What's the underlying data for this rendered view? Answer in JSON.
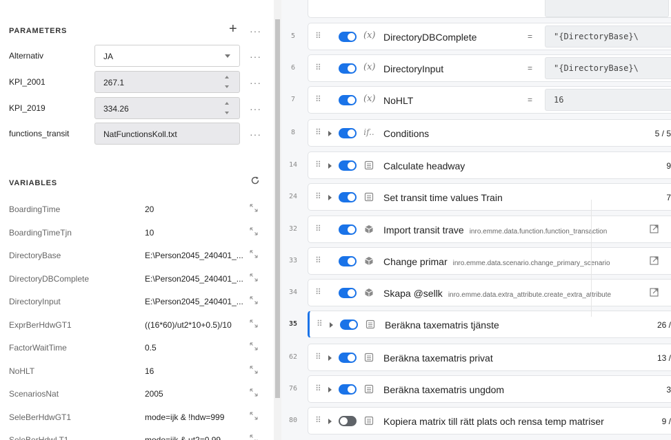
{
  "parameters": {
    "title": "PARAMETERS",
    "add_label": "+",
    "more_label": "···",
    "rows": [
      {
        "label": "Alternativ",
        "value": "JA",
        "kind": "select"
      },
      {
        "label": "KPI_2001",
        "value": "267.1",
        "kind": "number"
      },
      {
        "label": "KPI_2019",
        "value": "334.26",
        "kind": "number"
      },
      {
        "label": "functions_transit",
        "value": "NatFunctionsKoll.txt",
        "kind": "text"
      }
    ]
  },
  "variables": {
    "title": "VARIABLES",
    "refresh_icon": "refresh-icon",
    "rows": [
      {
        "name": "BoardingTime",
        "value": "20"
      },
      {
        "name": "BoardingTimeTjn",
        "value": "10"
      },
      {
        "name": "DirectoryBase",
        "value": "E:\\Person2045_240401_..."
      },
      {
        "name": "DirectoryDBComplete",
        "value": "E:\\Person2045_240401_..."
      },
      {
        "name": "DirectoryInput",
        "value": "E:\\Person2045_240401_..."
      },
      {
        "name": "ExprBerHdwGT1",
        "value": "((16*60)/ut2*10+0.5)/10"
      },
      {
        "name": "FactorWaitTime",
        "value": "0.5"
      },
      {
        "name": "NoHLT",
        "value": "16"
      },
      {
        "name": "ScenariosNat",
        "value": "2005"
      },
      {
        "name": "SeleBerHdwGT1",
        "value": "mode=ijk & !hdw=999"
      },
      {
        "name": "SeleBerHdwLT1",
        "value": "mode=ijk & ut2=0.99"
      }
    ]
  },
  "steps": [
    {
      "line": "5",
      "type": "var",
      "title": "DirectoryDBComplete",
      "eq": "=",
      "value": "\"{DirectoryBase}\\",
      "enabled": true
    },
    {
      "line": "6",
      "type": "var",
      "title": "DirectoryInput",
      "eq": "=",
      "value": "\"{DirectoryBase}\\",
      "enabled": true
    },
    {
      "line": "7",
      "type": "var",
      "title": "NoHLT",
      "eq": "=",
      "value": "16",
      "enabled": true
    },
    {
      "line": "8",
      "type": "if",
      "title": "Conditions",
      "count": "5 / 5",
      "expand": true,
      "enabled": true
    },
    {
      "line": "14",
      "type": "group",
      "title": "Calculate headway",
      "count": "9",
      "expand": true,
      "enabled": true
    },
    {
      "line": "24",
      "type": "group",
      "title": "Set transit time values Train",
      "count": "7",
      "expand": true,
      "enabled": true
    },
    {
      "line": "32",
      "type": "tool",
      "title": "Import transit trave",
      "sub": "inro.emme.data.function.function_transaction",
      "enabled": true
    },
    {
      "line": "33",
      "type": "tool",
      "title": "Change primar",
      "sub": "inro.emme.data.scenario.change_primary_scenario",
      "enabled": true
    },
    {
      "line": "34",
      "type": "tool",
      "title": "Skapa @sellk",
      "sub": "inro.emme.data.extra_attribute.create_extra_attribute",
      "enabled": true
    },
    {
      "line": "35",
      "type": "group",
      "title": "Beräkna taxematris tjänste",
      "count": "26 /",
      "expand": true,
      "enabled": true,
      "active": true
    },
    {
      "line": "62",
      "type": "group",
      "title": "Beräkna taxematris privat",
      "count": "13 /",
      "expand": true,
      "enabled": true
    },
    {
      "line": "76",
      "type": "group",
      "title": "Beräkna taxematris ungdom",
      "count": "3",
      "expand": true,
      "enabled": true
    },
    {
      "line": "80",
      "type": "group",
      "title": "Kopiera matrix till rätt plats och rensa temp matriser",
      "count": "9 /",
      "expand": true,
      "enabled": false
    }
  ],
  "colors": {
    "accent": "#1a73e8",
    "toggle_off": "#5f6368"
  }
}
